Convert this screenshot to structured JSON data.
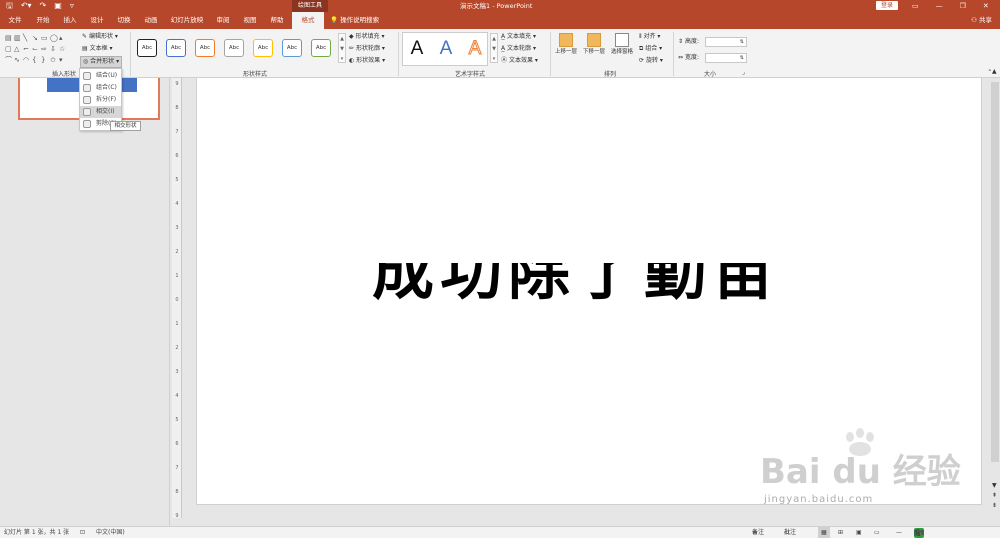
{
  "titlebar": {
    "context_title": "绘图工具",
    "document_title": "演示文稿1 - PowerPoint",
    "login": "登录",
    "share": "共享"
  },
  "tabs": [
    {
      "label": "文件"
    },
    {
      "label": "开始"
    },
    {
      "label": "插入"
    },
    {
      "label": "设计"
    },
    {
      "label": "切换"
    },
    {
      "label": "动画"
    },
    {
      "label": "幻灯片放映"
    },
    {
      "label": "审阅"
    },
    {
      "label": "视图"
    },
    {
      "label": "帮助"
    },
    {
      "label": "格式"
    },
    {
      "label": "操作说明搜索"
    }
  ],
  "ribbon": {
    "edit_shape": "编辑形状",
    "text_box": "文本框",
    "merge_shapes": "合并形状",
    "group_insert_shapes": "插入形状",
    "style_sample": "Abc",
    "shape_fill": "形状填充",
    "shape_outline": "形状轮廓",
    "shape_effects": "形状效果",
    "group_shape_styles": "形状样式",
    "wordart_sample": "A",
    "text_fill": "文本填充",
    "text_outline": "文本轮廓",
    "text_effects": "文本效果",
    "group_wordart": "艺术字样式",
    "bring_forward": "上移一层",
    "send_backward": "下移一层",
    "selection_pane": "选择窗格",
    "align": "对齐",
    "group": "组合",
    "rotate": "旋转",
    "group_arrange": "排列",
    "height_label": "高度:",
    "width_label": "宽度:",
    "group_size": "大小"
  },
  "merge_menu": {
    "items": [
      {
        "label": "结合(U)"
      },
      {
        "label": "组合(C)"
      },
      {
        "label": "拆分(F)"
      },
      {
        "label": "相交(I)"
      },
      {
        "label": "剪除(S)"
      }
    ],
    "tooltip": "相交形状"
  },
  "slide": {
    "text": "成功除了勤苗"
  },
  "watermark": {
    "brand": "Bai du 经验",
    "url": "jingyan.baidu.com"
  },
  "statusbar": {
    "slide_info": "幻灯片 第 1 张，共 1 张",
    "language": "中文(中国)",
    "notes": "备注",
    "comments": "批注",
    "ime_label": "五"
  },
  "colors": {
    "accent": "#b7472a",
    "thumb_border": "#e0785a",
    "thumb_bar": "#4472c4"
  }
}
